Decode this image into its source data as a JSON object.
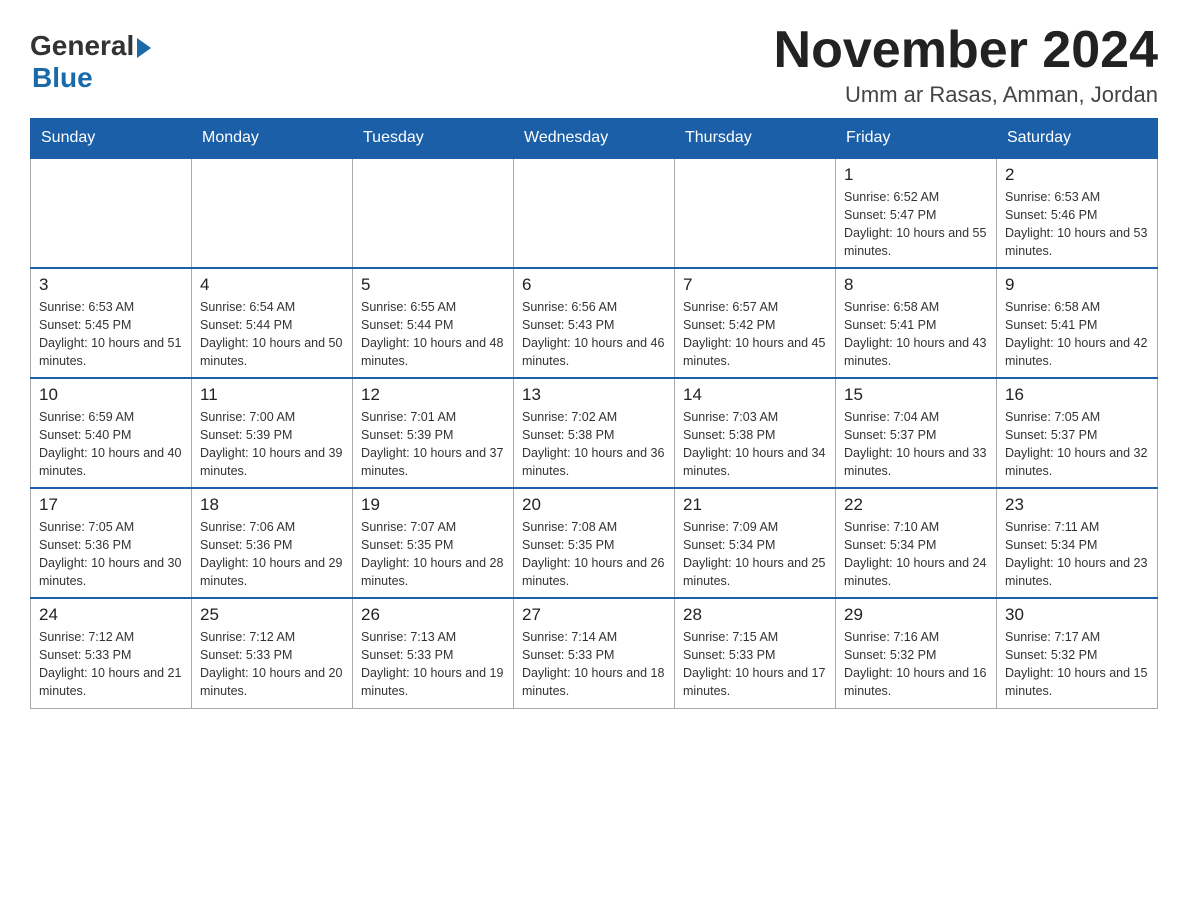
{
  "logo": {
    "general": "General",
    "blue": "Blue"
  },
  "header": {
    "month": "November 2024",
    "location": "Umm ar Rasas, Amman, Jordan"
  },
  "weekdays": [
    "Sunday",
    "Monday",
    "Tuesday",
    "Wednesday",
    "Thursday",
    "Friday",
    "Saturday"
  ],
  "weeks": [
    [
      {
        "day": "",
        "sunrise": "",
        "sunset": "",
        "daylight": ""
      },
      {
        "day": "",
        "sunrise": "",
        "sunset": "",
        "daylight": ""
      },
      {
        "day": "",
        "sunrise": "",
        "sunset": "",
        "daylight": ""
      },
      {
        "day": "",
        "sunrise": "",
        "sunset": "",
        "daylight": ""
      },
      {
        "day": "",
        "sunrise": "",
        "sunset": "",
        "daylight": ""
      },
      {
        "day": "1",
        "sunrise": "Sunrise: 6:52 AM",
        "sunset": "Sunset: 5:47 PM",
        "daylight": "Daylight: 10 hours and 55 minutes."
      },
      {
        "day": "2",
        "sunrise": "Sunrise: 6:53 AM",
        "sunset": "Sunset: 5:46 PM",
        "daylight": "Daylight: 10 hours and 53 minutes."
      }
    ],
    [
      {
        "day": "3",
        "sunrise": "Sunrise: 6:53 AM",
        "sunset": "Sunset: 5:45 PM",
        "daylight": "Daylight: 10 hours and 51 minutes."
      },
      {
        "day": "4",
        "sunrise": "Sunrise: 6:54 AM",
        "sunset": "Sunset: 5:44 PM",
        "daylight": "Daylight: 10 hours and 50 minutes."
      },
      {
        "day": "5",
        "sunrise": "Sunrise: 6:55 AM",
        "sunset": "Sunset: 5:44 PM",
        "daylight": "Daylight: 10 hours and 48 minutes."
      },
      {
        "day": "6",
        "sunrise": "Sunrise: 6:56 AM",
        "sunset": "Sunset: 5:43 PM",
        "daylight": "Daylight: 10 hours and 46 minutes."
      },
      {
        "day": "7",
        "sunrise": "Sunrise: 6:57 AM",
        "sunset": "Sunset: 5:42 PM",
        "daylight": "Daylight: 10 hours and 45 minutes."
      },
      {
        "day": "8",
        "sunrise": "Sunrise: 6:58 AM",
        "sunset": "Sunset: 5:41 PM",
        "daylight": "Daylight: 10 hours and 43 minutes."
      },
      {
        "day": "9",
        "sunrise": "Sunrise: 6:58 AM",
        "sunset": "Sunset: 5:41 PM",
        "daylight": "Daylight: 10 hours and 42 minutes."
      }
    ],
    [
      {
        "day": "10",
        "sunrise": "Sunrise: 6:59 AM",
        "sunset": "Sunset: 5:40 PM",
        "daylight": "Daylight: 10 hours and 40 minutes."
      },
      {
        "day": "11",
        "sunrise": "Sunrise: 7:00 AM",
        "sunset": "Sunset: 5:39 PM",
        "daylight": "Daylight: 10 hours and 39 minutes."
      },
      {
        "day": "12",
        "sunrise": "Sunrise: 7:01 AM",
        "sunset": "Sunset: 5:39 PM",
        "daylight": "Daylight: 10 hours and 37 minutes."
      },
      {
        "day": "13",
        "sunrise": "Sunrise: 7:02 AM",
        "sunset": "Sunset: 5:38 PM",
        "daylight": "Daylight: 10 hours and 36 minutes."
      },
      {
        "day": "14",
        "sunrise": "Sunrise: 7:03 AM",
        "sunset": "Sunset: 5:38 PM",
        "daylight": "Daylight: 10 hours and 34 minutes."
      },
      {
        "day": "15",
        "sunrise": "Sunrise: 7:04 AM",
        "sunset": "Sunset: 5:37 PM",
        "daylight": "Daylight: 10 hours and 33 minutes."
      },
      {
        "day": "16",
        "sunrise": "Sunrise: 7:05 AM",
        "sunset": "Sunset: 5:37 PM",
        "daylight": "Daylight: 10 hours and 32 minutes."
      }
    ],
    [
      {
        "day": "17",
        "sunrise": "Sunrise: 7:05 AM",
        "sunset": "Sunset: 5:36 PM",
        "daylight": "Daylight: 10 hours and 30 minutes."
      },
      {
        "day": "18",
        "sunrise": "Sunrise: 7:06 AM",
        "sunset": "Sunset: 5:36 PM",
        "daylight": "Daylight: 10 hours and 29 minutes."
      },
      {
        "day": "19",
        "sunrise": "Sunrise: 7:07 AM",
        "sunset": "Sunset: 5:35 PM",
        "daylight": "Daylight: 10 hours and 28 minutes."
      },
      {
        "day": "20",
        "sunrise": "Sunrise: 7:08 AM",
        "sunset": "Sunset: 5:35 PM",
        "daylight": "Daylight: 10 hours and 26 minutes."
      },
      {
        "day": "21",
        "sunrise": "Sunrise: 7:09 AM",
        "sunset": "Sunset: 5:34 PM",
        "daylight": "Daylight: 10 hours and 25 minutes."
      },
      {
        "day": "22",
        "sunrise": "Sunrise: 7:10 AM",
        "sunset": "Sunset: 5:34 PM",
        "daylight": "Daylight: 10 hours and 24 minutes."
      },
      {
        "day": "23",
        "sunrise": "Sunrise: 7:11 AM",
        "sunset": "Sunset: 5:34 PM",
        "daylight": "Daylight: 10 hours and 23 minutes."
      }
    ],
    [
      {
        "day": "24",
        "sunrise": "Sunrise: 7:12 AM",
        "sunset": "Sunset: 5:33 PM",
        "daylight": "Daylight: 10 hours and 21 minutes."
      },
      {
        "day": "25",
        "sunrise": "Sunrise: 7:12 AM",
        "sunset": "Sunset: 5:33 PM",
        "daylight": "Daylight: 10 hours and 20 minutes."
      },
      {
        "day": "26",
        "sunrise": "Sunrise: 7:13 AM",
        "sunset": "Sunset: 5:33 PM",
        "daylight": "Daylight: 10 hours and 19 minutes."
      },
      {
        "day": "27",
        "sunrise": "Sunrise: 7:14 AM",
        "sunset": "Sunset: 5:33 PM",
        "daylight": "Daylight: 10 hours and 18 minutes."
      },
      {
        "day": "28",
        "sunrise": "Sunrise: 7:15 AM",
        "sunset": "Sunset: 5:33 PM",
        "daylight": "Daylight: 10 hours and 17 minutes."
      },
      {
        "day": "29",
        "sunrise": "Sunrise: 7:16 AM",
        "sunset": "Sunset: 5:32 PM",
        "daylight": "Daylight: 10 hours and 16 minutes."
      },
      {
        "day": "30",
        "sunrise": "Sunrise: 7:17 AM",
        "sunset": "Sunset: 5:32 PM",
        "daylight": "Daylight: 10 hours and 15 minutes."
      }
    ]
  ]
}
